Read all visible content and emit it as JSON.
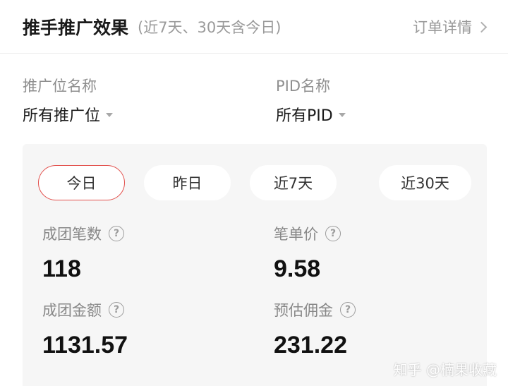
{
  "header": {
    "title": "推手推广效果",
    "subtitle": "(近7天、30天含今日)",
    "order_link": "订单详情"
  },
  "filters": {
    "slot": {
      "label": "推广位名称",
      "value": "所有推广位"
    },
    "pid": {
      "label": "PID名称",
      "value": "所有PID"
    }
  },
  "tabs": [
    {
      "label": "今日",
      "active": true
    },
    {
      "label": "昨日",
      "active": false
    },
    {
      "label": "近7天",
      "active": false
    },
    {
      "label": "近30天",
      "active": false
    }
  ],
  "stats": {
    "group_orders": {
      "label": "成团笔数",
      "value": "118"
    },
    "unit_price": {
      "label": "笔单价",
      "value": "9.58"
    },
    "group_amount": {
      "label": "成团金额",
      "value": "1131.57"
    },
    "est_commission": {
      "label": "预估佣金",
      "value": "231.22"
    }
  },
  "help_icon_glyph": "?",
  "watermark": "知乎 @楠果收藏",
  "colors": {
    "accent": "#e2504c",
    "panel_bg": "#f6f6f6",
    "muted_text": "#9a9a9a"
  }
}
